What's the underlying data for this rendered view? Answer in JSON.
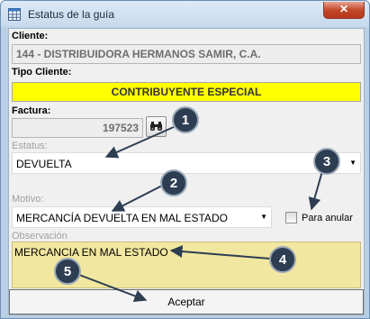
{
  "window": {
    "title": "Estatus de la guía",
    "close_glyph": "✕"
  },
  "cliente": {
    "label": "Cliente:",
    "value": "144 - DISTRIBUIDORA HERMANOS SAMIR, C.A."
  },
  "tipo_cliente": {
    "label": "Tipo Cliente:",
    "value": "CONTRIBUYENTE ESPECIAL"
  },
  "factura": {
    "label": "Factura:",
    "value": "197523",
    "search_icon": "binoculars-icon"
  },
  "estatus": {
    "label": "Estatus:",
    "selected": "DEVUELTA",
    "arrow": "▼"
  },
  "motivo": {
    "label": "Motivo:",
    "selected": "MERCANCÍA DEVUELTA EN MAL ESTADO",
    "arrow": "▼"
  },
  "para_anular": {
    "label": "Para anular",
    "checked": false
  },
  "observacion": {
    "label": "Observación",
    "value": "MERCANCIA EN MAL ESTADO"
  },
  "accept": {
    "label": "Aceptar"
  },
  "callouts": {
    "n1": "1",
    "n2": "2",
    "n3": "3",
    "n4": "4",
    "n5": "5"
  },
  "colors": {
    "highlight": "#ffff00",
    "observacion_bg": "#f2e7a0",
    "callout": "#2e3e52"
  }
}
